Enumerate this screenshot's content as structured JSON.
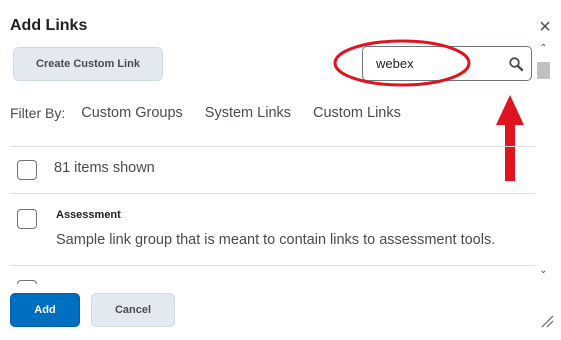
{
  "dialog": {
    "title": "Add Links",
    "close_glyph": "×"
  },
  "toolbar": {
    "create_custom_link_label": "Create Custom Link"
  },
  "search": {
    "value": "webex",
    "icon": "search-icon"
  },
  "filter": {
    "label": "Filter By:",
    "items": [
      "Custom Groups",
      "System Links",
      "Custom Links"
    ]
  },
  "list": {
    "summary": "81 items shown",
    "rows": [
      {
        "title": "Assessment",
        "description": "Sample link group that is meant to contain links to assessment tools."
      }
    ]
  },
  "footer": {
    "add_label": "Add",
    "cancel_label": "Cancel"
  },
  "annotation": {
    "color": "#e0141e"
  }
}
